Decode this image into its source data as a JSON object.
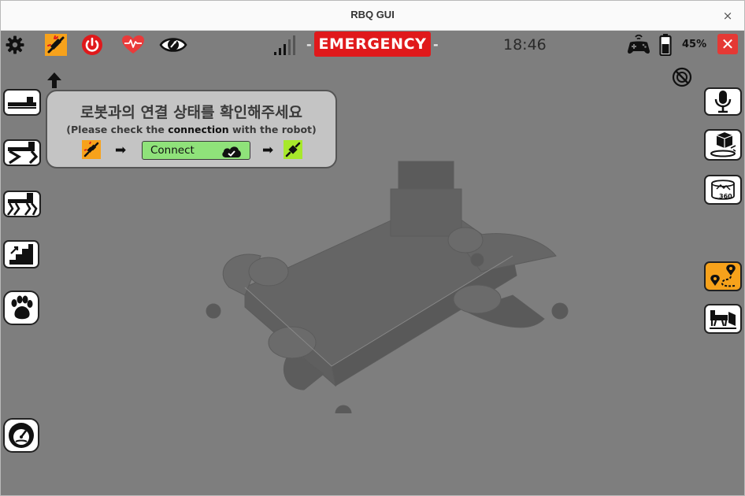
{
  "window": {
    "title": "RBQ GUI",
    "close_glyph": "×"
  },
  "topbar": {
    "icons": [
      "gear-icon",
      "plug-disconnected-icon",
      "power-icon",
      "heartbeat-icon",
      "eye-icon"
    ],
    "signal_dash_left": "-",
    "emergency_label": "EMERGENCY",
    "signal_dash_right": "-",
    "clock": "18:46",
    "battery_percent": "45%",
    "close_label": "✕"
  },
  "tip": {
    "korean": "로봇과의 연결 상태를 확인해주세요",
    "english_before": "(Please check the ",
    "english_bold": "connection",
    "english_after": " with the robot)",
    "arrow_1": "➡",
    "connect_label": "Connect",
    "arrow_2": "➡"
  },
  "left_buttons": [
    "robot-lying-icon",
    "robot-sitting-icon",
    "robot-standing-icon",
    "stairs-icon",
    "paw-icon",
    "speedometer-icon"
  ],
  "right_buttons": [
    "microphone-icon",
    "object-detect-icon",
    "camera-360-icon",
    "waypoint-path-icon",
    "docking-icon"
  ],
  "colors": {
    "background": "#7e7e7e",
    "emergency": "#e0191b",
    "plug_disconnected": "#f7a21b",
    "plug_connected": "#a7e82b",
    "connect_button": "#8fe27a",
    "close_red": "#e53935",
    "active_side_button": "#f7a21b"
  }
}
